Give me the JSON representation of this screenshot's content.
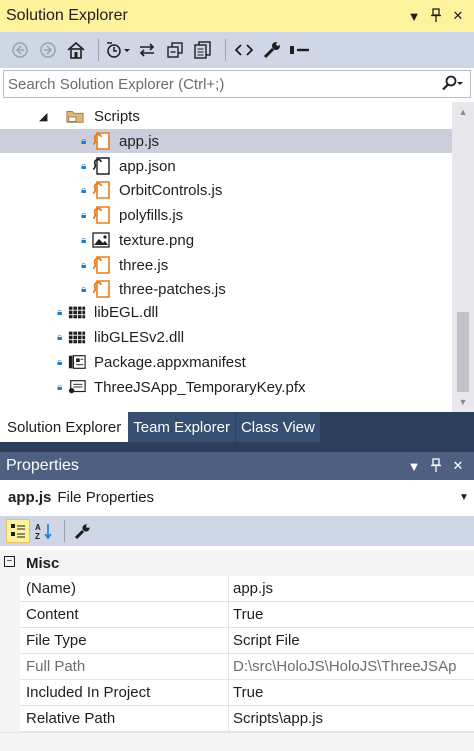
{
  "solution_explorer": {
    "title": "Solution Explorer",
    "title_icons": [
      "dropdown-icon",
      "pin-icon",
      "close-icon"
    ],
    "toolbar_icons": [
      "back-icon",
      "forward-icon",
      "home-icon",
      "pending-changes-filter-icon",
      "sync-with-active-document-icon",
      "collapse-all-icon",
      "show-all-files-icon",
      "view-code-icon",
      "properties-icon",
      "preview-selected-items-icon"
    ],
    "search_placeholder": "Search Solution Explorer (Ctrl+;)",
    "tree": [
      {
        "label": "Scripts",
        "type": "folder",
        "expanded": true
      },
      {
        "label": "app.js",
        "type": "js",
        "selected": true
      },
      {
        "label": "app.json",
        "type": "json"
      },
      {
        "label": "OrbitControls.js",
        "type": "js"
      },
      {
        "label": "polyfills.js",
        "type": "js"
      },
      {
        "label": "texture.png",
        "type": "image"
      },
      {
        "label": "three.js",
        "type": "js"
      },
      {
        "label": "three-patches.js",
        "type": "js"
      },
      {
        "label": "libEGL.dll",
        "type": "dll"
      },
      {
        "label": "libGLESv2.dll",
        "type": "dll"
      },
      {
        "label": "Package.appxmanifest",
        "type": "manifest"
      },
      {
        "label": "ThreeJSApp_TemporaryKey.pfx",
        "type": "certificate"
      }
    ]
  },
  "tabs": [
    "Solution Explorer",
    "Team Explorer",
    "Class View"
  ],
  "properties": {
    "title": "Properties",
    "object_name": "app.js",
    "object_type": "File Properties",
    "category": "Misc",
    "rows": [
      {
        "key": "(Name)",
        "value": "app.js"
      },
      {
        "key": "Content",
        "value": "True"
      },
      {
        "key": "File Type",
        "value": "Script File"
      },
      {
        "key": "Full Path",
        "value": "D:\\src\\HoloJS\\HoloJS\\ThreeJSAp"
      },
      {
        "key": "Included In Project",
        "value": "True"
      },
      {
        "key": "Relative Path",
        "value": "Scripts\\app.js"
      }
    ]
  },
  "colors": {
    "active_title": "#fff29d",
    "toolbar": "#cfd6e5",
    "tab_strip": "#2d3e5c",
    "inactive_title": "#4d6082",
    "selection": "#cccedb",
    "js_icon": "#e87c1e",
    "lock": "#1e7fc8"
  }
}
